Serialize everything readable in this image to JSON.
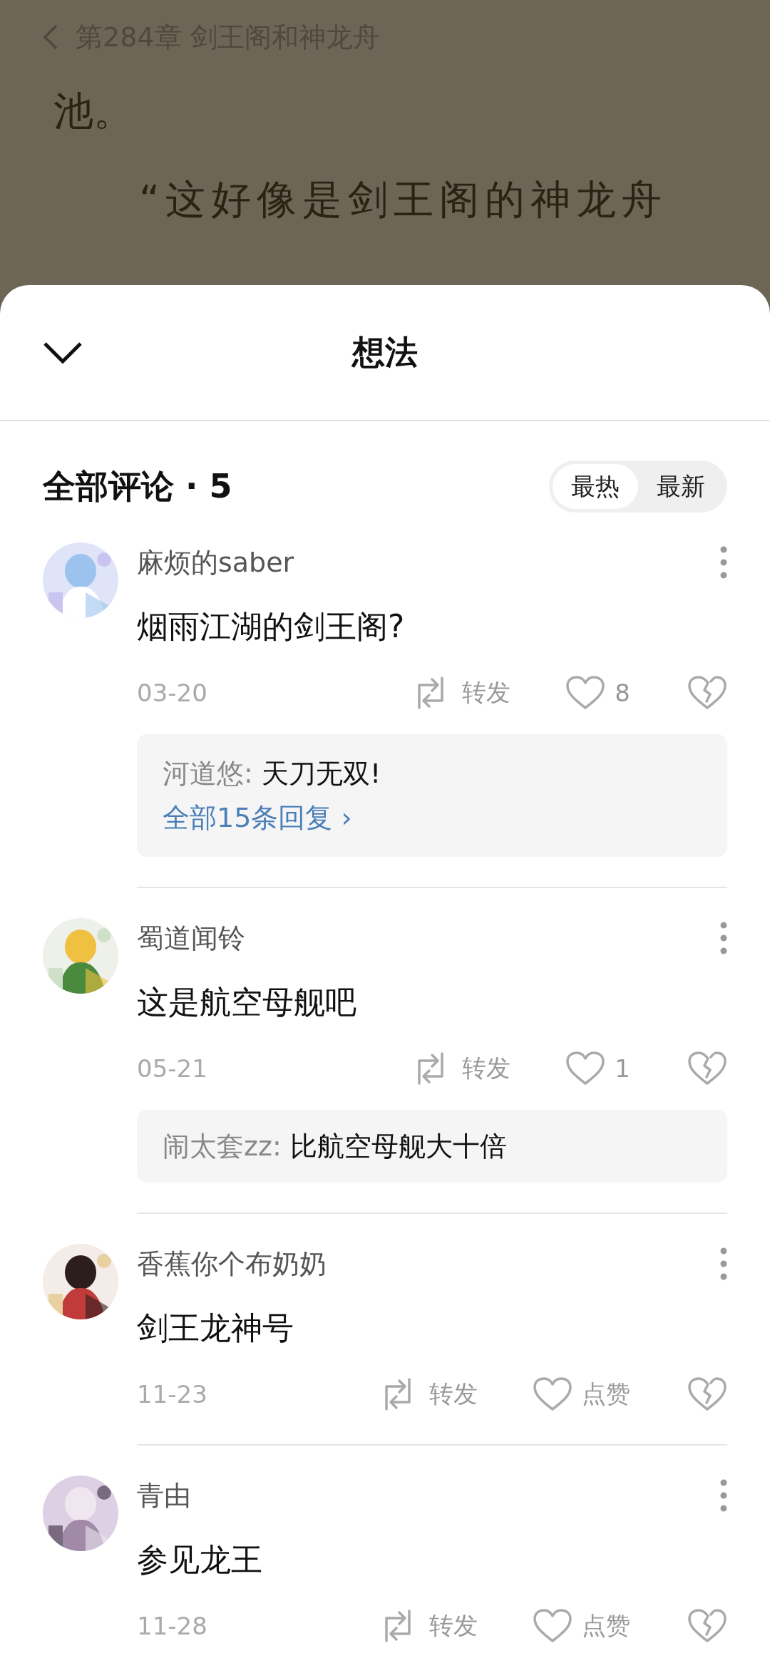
{
  "reader": {
    "chapter_title": "第284章 剑王阁和神龙舟",
    "paragraphs": [
      "池。",
      "“这好像是剑王阁的神龙舟"
    ]
  },
  "sheet": {
    "title": "想法"
  },
  "comments_header": {
    "title": "全部评论 · 5"
  },
  "sort_options": [
    {
      "label": "最热",
      "selected": true
    },
    {
      "label": "最新",
      "selected": false
    }
  ],
  "comments": [
    {
      "user": "麻烦的saber",
      "text": "烟雨江湖的剑王阁?",
      "date": "03-20",
      "repost_label": "转发",
      "like_label": "8",
      "reply_preview": {
        "author": "河道悠:",
        "text": "天刀无双!"
      },
      "view_all_replies": "全部15条回复 ›"
    },
    {
      "user": "蜀道闻铃",
      "text": "这是航空母舰吧",
      "date": "05-21",
      "repost_label": "转发",
      "like_label": "1",
      "reply_preview": {
        "author": "闹太套zz:",
        "text": "比航空母舰大十倍"
      }
    },
    {
      "user": "香蕉你个布奶奶",
      "text": "剑王龙神号",
      "date": "11-23",
      "repost_label": "转发",
      "like_label": "点赞"
    },
    {
      "user": "青由",
      "text": "参见龙王",
      "date": "11-28",
      "repost_label": "转发",
      "like_label": "点赞"
    }
  ]
}
